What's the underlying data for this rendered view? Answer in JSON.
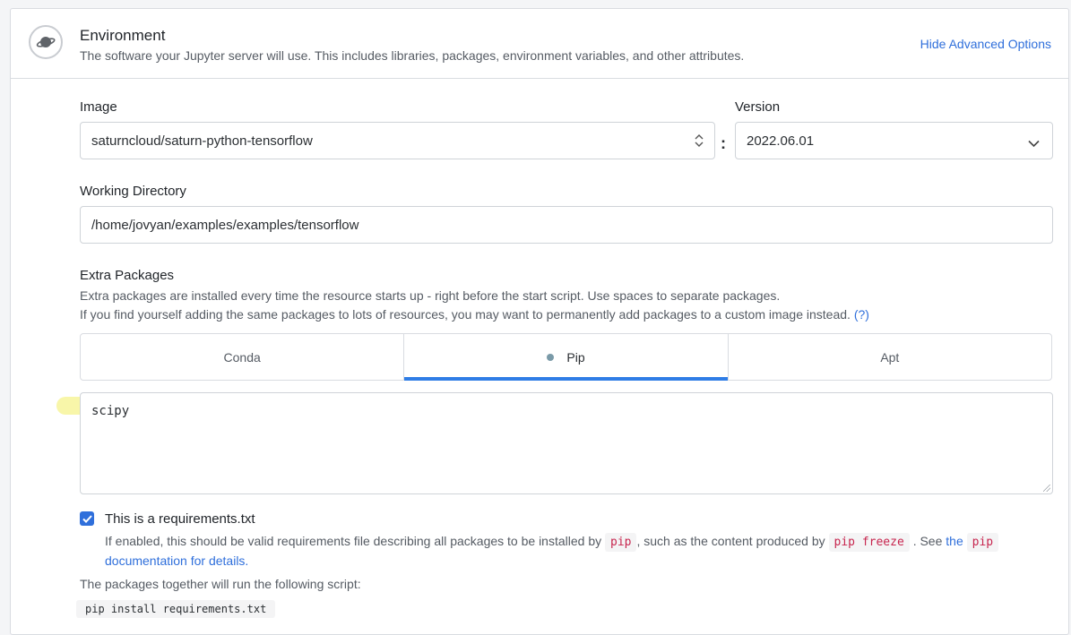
{
  "header": {
    "title": "Environment",
    "subtitle": "The software your Jupyter server will use. This includes libraries, packages, environment variables, and other attributes.",
    "advanced_link": "Hide Advanced Options",
    "icon": "planet-icon"
  },
  "image": {
    "label": "Image",
    "value": "saturncloud/saturn-python-tensorflow"
  },
  "version": {
    "label": "Version",
    "value": "2022.06.01",
    "separator": ":"
  },
  "working_directory": {
    "label": "Working Directory",
    "value": "/home/jovyan/examples/examples/tensorflow"
  },
  "extra_packages": {
    "label": "Extra Packages",
    "desc_line1": "Extra packages are installed every time the resource starts up - right before the start script. Use spaces to separate packages.",
    "desc_line2": "If you find yourself adding the same packages to lots of resources, you may want to permanently add packages to a custom image instead.",
    "help_link": "(?)",
    "tabs": [
      "Conda",
      "Pip",
      "Apt"
    ],
    "active_tab": "Pip",
    "textarea_value": "scipy"
  },
  "requirements": {
    "checked": true,
    "label": "This is a requirements.txt",
    "desc_part1": "If enabled, this should be valid requirements file describing all packages to be installed by",
    "code1": "pip",
    "desc_part2": ", such as the content produced by",
    "code2": "pip freeze",
    "desc_part3": ". See",
    "link_text1": "the",
    "code3": "pip",
    "link_text2": "documentation for details."
  },
  "script": {
    "label": "The packages together will run the following script:",
    "command": "pip install requirements.txt"
  },
  "colors": {
    "accent": "#2f6fdb",
    "tab_underline": "#2f7de6",
    "highlight": "#f7f59a",
    "code_text": "#c7254e"
  }
}
